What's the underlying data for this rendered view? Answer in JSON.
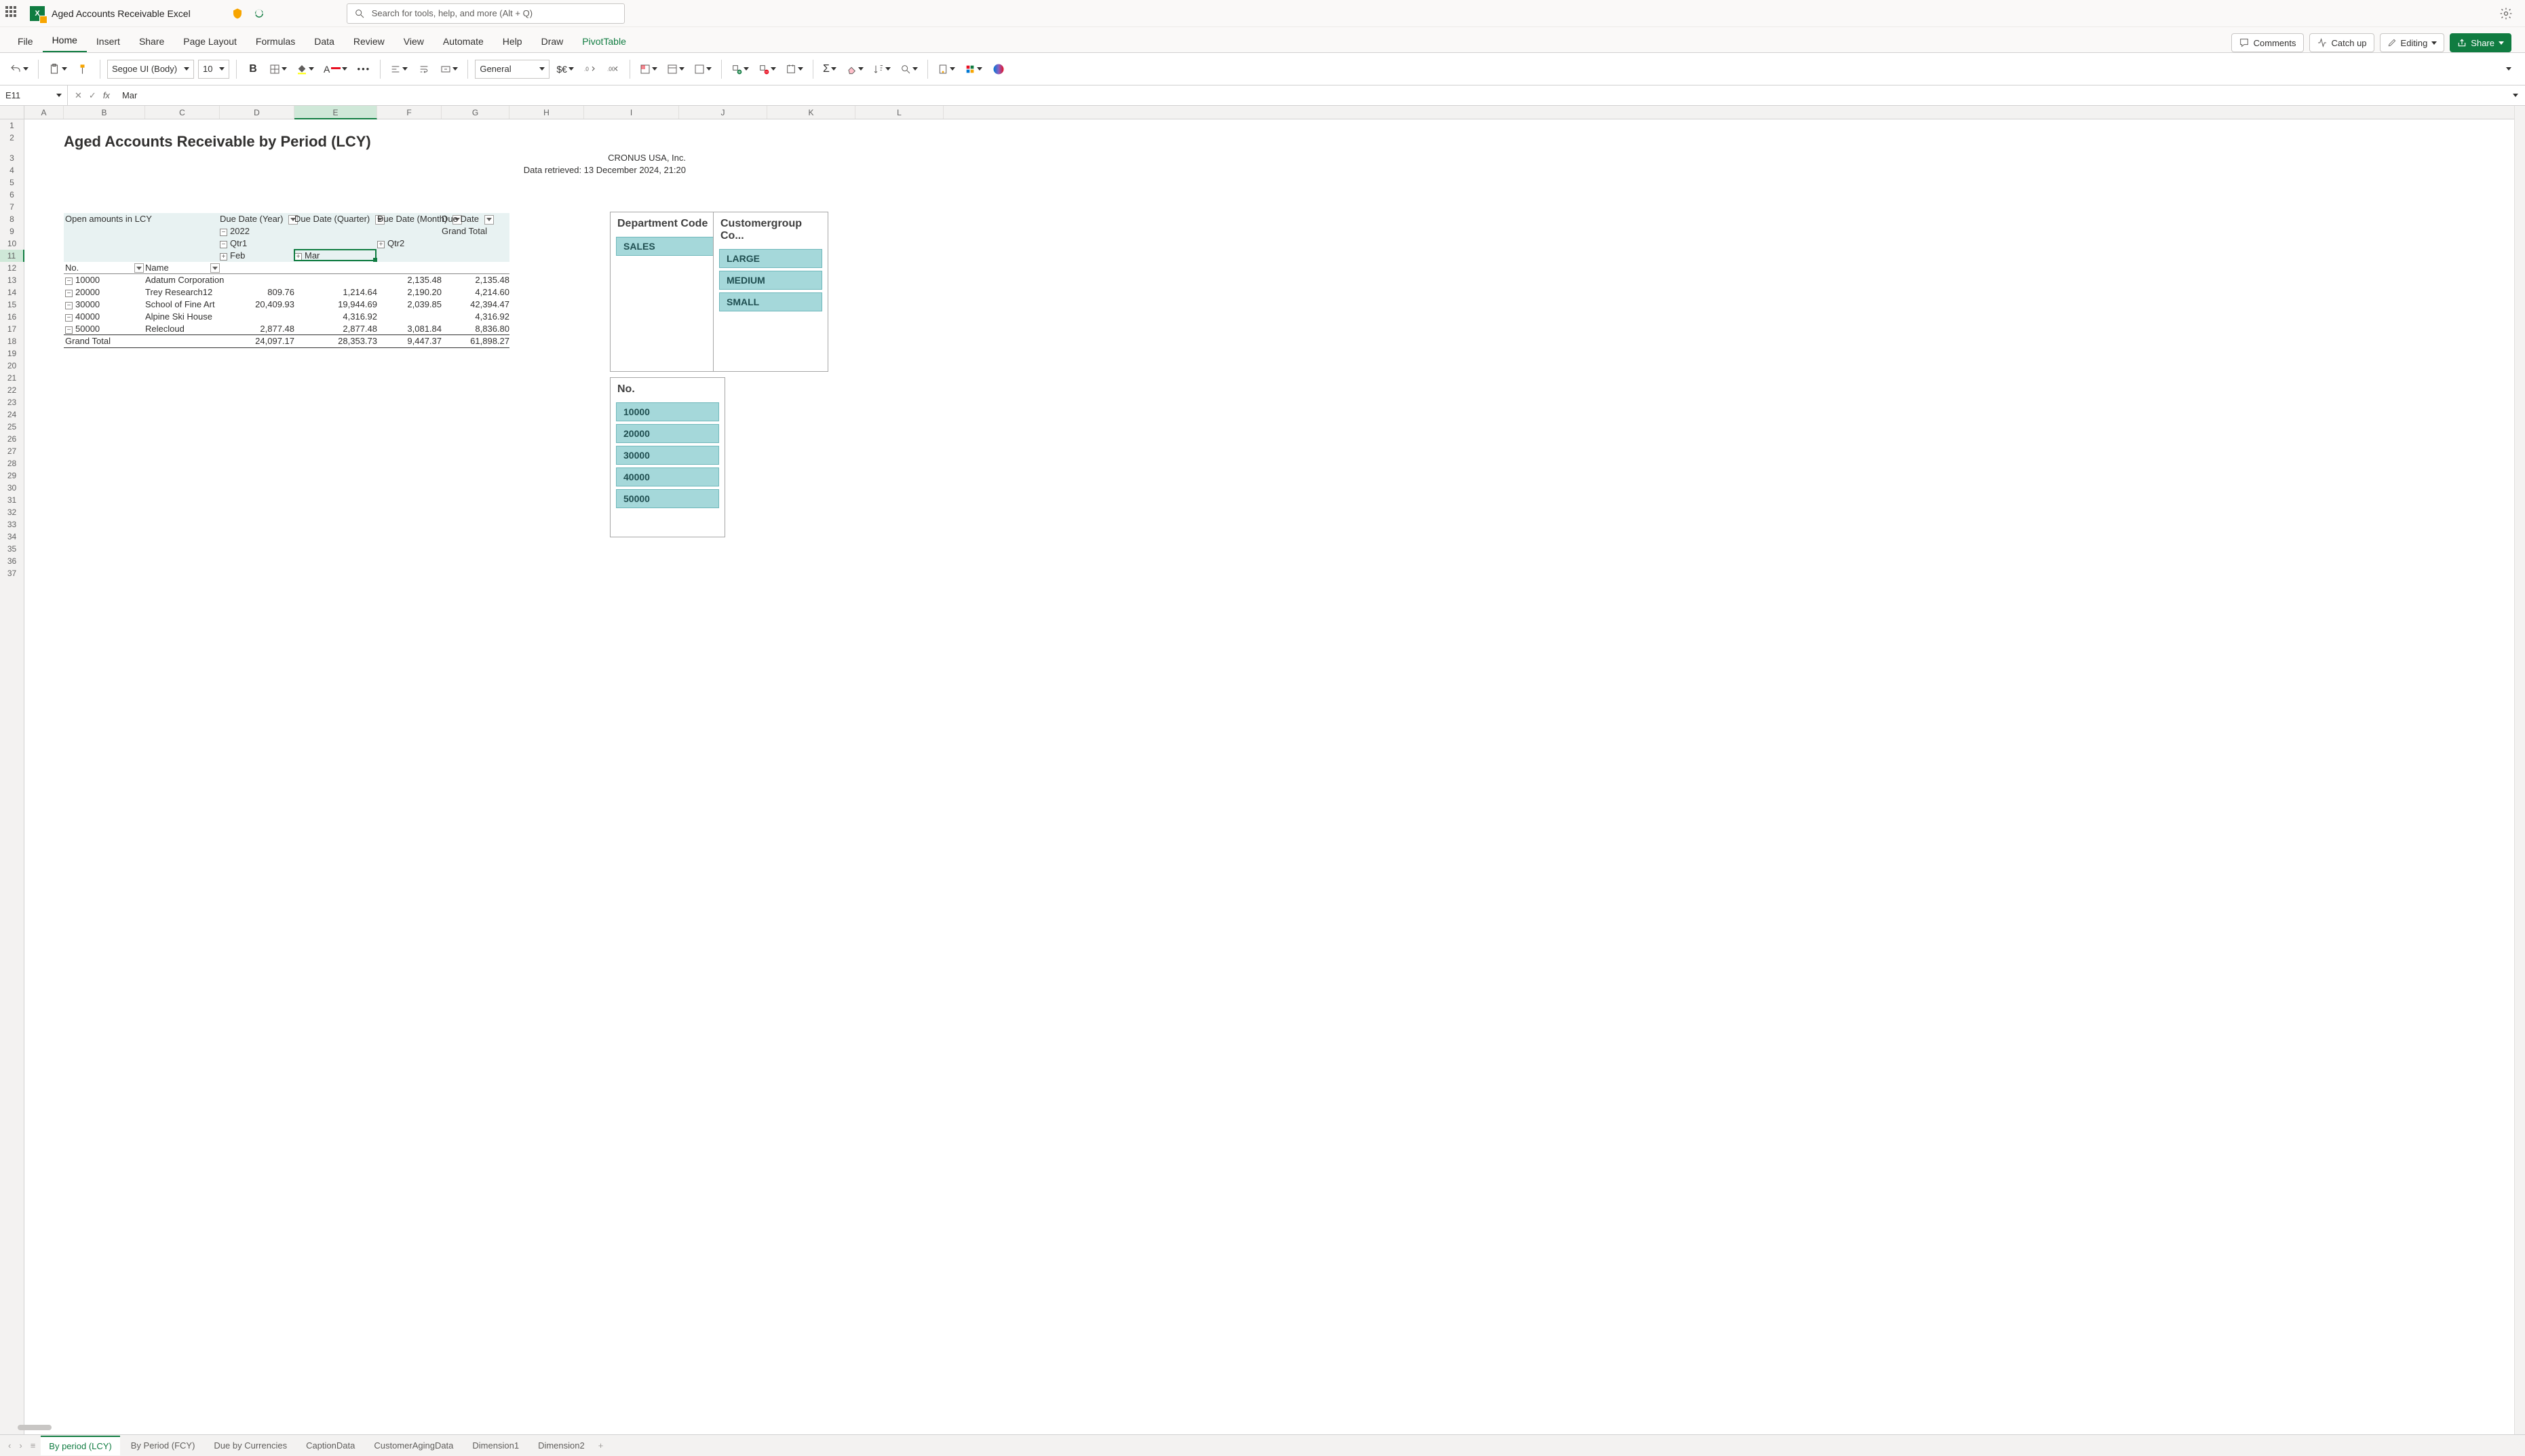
{
  "titlebar": {
    "doc_title": "Aged Accounts Receivable Excel",
    "search_placeholder": "Search for tools, help, and more (Alt + Q)"
  },
  "tabs": {
    "file": "File",
    "home": "Home",
    "insert": "Insert",
    "share": "Share",
    "page_layout": "Page Layout",
    "formulas": "Formulas",
    "data": "Data",
    "review": "Review",
    "view": "View",
    "automate": "Automate",
    "help": "Help",
    "draw": "Draw",
    "pivottable": "PivotTable"
  },
  "ribbon_right": {
    "comments": "Comments",
    "catch_up": "Catch up",
    "editing": "Editing",
    "share": "Share"
  },
  "toolbar": {
    "font_name": "Segoe UI (Body)",
    "font_size": "10",
    "number_format": "General"
  },
  "formula_bar": {
    "name_box": "E11",
    "value": "Mar"
  },
  "columns": [
    "A",
    "B",
    "C",
    "D",
    "E",
    "F",
    "G",
    "H",
    "I",
    "J",
    "K",
    "L"
  ],
  "report": {
    "title": "Aged Accounts Receivable by Period (LCY)",
    "company": "CRONUS USA, Inc.",
    "retrieved": "Data retrieved: 13 December 2024, 21:20",
    "open_amounts": "Open amounts in LCY",
    "col_year": "Due Date (Year)",
    "col_quarter": "Due Date (Quarter)",
    "col_month": "Due Date (Month)",
    "col_due": "Due Date",
    "grand_total_col": "Grand Total",
    "y2022": "2022",
    "q1": "Qtr1",
    "q2": "Qtr2",
    "feb": "Feb",
    "mar": "Mar",
    "no_hdr": "No.",
    "name_hdr": "Name",
    "rows": [
      {
        "no": "10000",
        "name": "Adatum Corporation",
        "feb": "",
        "mar": "",
        "month": "2,135.48",
        "total": "2,135.48"
      },
      {
        "no": "20000",
        "name": "Trey Research12",
        "feb": "809.76",
        "mar": "1,214.64",
        "month": "2,190.20",
        "total": "4,214.60"
      },
      {
        "no": "30000",
        "name": "School of Fine Art",
        "feb": "20,409.93",
        "mar": "19,944.69",
        "month": "2,039.85",
        "total": "42,394.47"
      },
      {
        "no": "40000",
        "name": "Alpine Ski House",
        "feb": "",
        "mar": "4,316.92",
        "month": "",
        "total": "4,316.92"
      },
      {
        "no": "50000",
        "name": "Relecloud",
        "feb": "2,877.48",
        "mar": "2,877.48",
        "month": "3,081.84",
        "total": "8,836.80"
      }
    ],
    "grand_row": {
      "label": "Grand Total",
      "feb": "24,097.17",
      "mar": "28,353.73",
      "month": "9,447.37",
      "total": "61,898.27"
    }
  },
  "slicers": {
    "dept_title": "Department Code",
    "dept_items": [
      "SALES"
    ],
    "cust_title": "Customergroup Co...",
    "cust_items": [
      "LARGE",
      "MEDIUM",
      "SMALL"
    ],
    "no_title": "No.",
    "no_items": [
      "10000",
      "20000",
      "30000",
      "40000",
      "50000"
    ]
  },
  "sheets": {
    "by_period_lcy": "By period (LCY)",
    "by_period_fcy": "By Period (FCY)",
    "due_currencies": "Due by Currencies",
    "caption": "CaptionData",
    "aging": "CustomerAgingData",
    "dim1": "Dimension1",
    "dim2": "Dimension2"
  }
}
